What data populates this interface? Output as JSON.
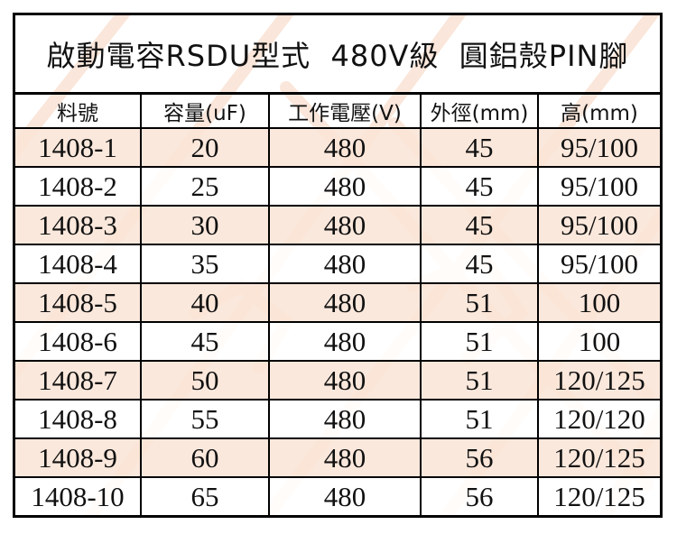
{
  "title": "啟動電容RSDU型式  480V級  圓鋁殼PIN腳",
  "headers": [
    "料號",
    "容量(uF)",
    "工作電壓(V)",
    "外徑(mm)",
    "高(mm)"
  ],
  "rows": [
    [
      "1408-1",
      "20",
      "480",
      "45",
      "95/100"
    ],
    [
      "1408-2",
      "25",
      "480",
      "45",
      "95/100"
    ],
    [
      "1408-3",
      "30",
      "480",
      "45",
      "95/100"
    ],
    [
      "1408-4",
      "35",
      "480",
      "45",
      "95/100"
    ],
    [
      "1408-5",
      "40",
      "480",
      "51",
      "100"
    ],
    [
      "1408-6",
      "45",
      "480",
      "51",
      "100"
    ],
    [
      "1408-7",
      "50",
      "480",
      "51",
      "120/125"
    ],
    [
      "1408-8",
      "55",
      "480",
      "51",
      "120/120"
    ],
    [
      "1408-9",
      "60",
      "480",
      "56",
      "120/125"
    ],
    [
      "1408-10",
      "65",
      "480",
      "56",
      "120/125"
    ]
  ],
  "colors": {
    "stripe": "#fae4d6",
    "watermark": "#f7d2bd",
    "border": "#000000"
  }
}
